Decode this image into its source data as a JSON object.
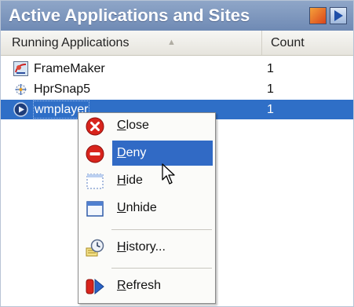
{
  "window": {
    "title": "Active Applications and Sites"
  },
  "columns": {
    "name": "Running Applications",
    "sort_indicator": "▲",
    "count": "Count"
  },
  "rows": [
    {
      "name": "FrameMaker",
      "count": "1",
      "icon": "framemaker-icon"
    },
    {
      "name": "HprSnap5",
      "count": "1",
      "icon": "hprsnap-icon"
    },
    {
      "name": "wmplayer",
      "count": "1",
      "icon": "wmplayer-icon"
    }
  ],
  "menu": {
    "items": [
      {
        "first": "C",
        "rest": "lose",
        "icon": "close-icon"
      },
      {
        "first": "D",
        "rest": "eny",
        "icon": "deny-icon",
        "highlighted": true
      },
      {
        "first": "H",
        "rest": "ide",
        "icon": "hide-icon"
      },
      {
        "first": "U",
        "rest": "nhide",
        "icon": "unhide-icon"
      },
      {
        "first": "H",
        "rest": "istory...",
        "icon": "history-icon"
      },
      {
        "first": "R",
        "rest": "efresh",
        "icon": "refresh-icon"
      }
    ]
  },
  "colors": {
    "titlebar": "#7a93bd",
    "selection": "#2f6fc7",
    "menu_highlight": "#316ac5"
  }
}
